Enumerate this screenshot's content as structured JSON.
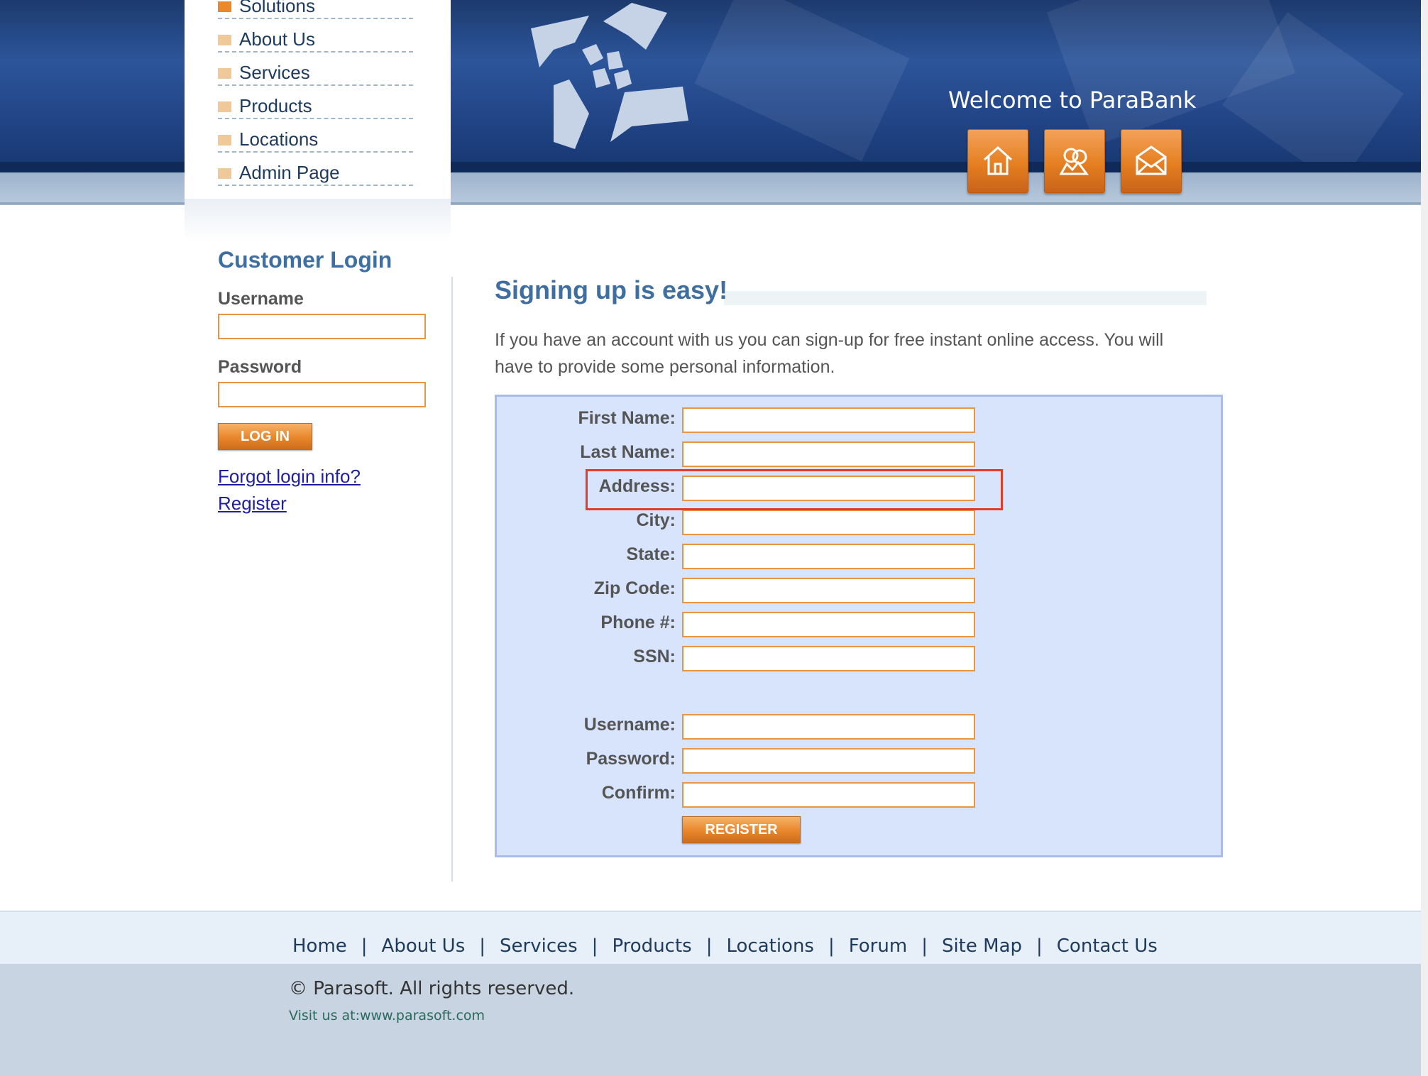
{
  "header": {
    "welcome": "Welcome to ParaBank",
    "icons": [
      "home-icon",
      "about-people-icon",
      "contact-mail-icon"
    ],
    "colors": {
      "band": "#25498c",
      "button": "#e57f21"
    }
  },
  "sidebar_nav": {
    "items": [
      {
        "label": "Solutions"
      },
      {
        "label": "About Us"
      },
      {
        "label": "Services"
      },
      {
        "label": "Products"
      },
      {
        "label": "Locations"
      },
      {
        "label": "Admin Page"
      }
    ]
  },
  "login": {
    "title": "Customer Login",
    "username_label": "Username",
    "username_value": "",
    "password_label": "Password",
    "password_value": "",
    "login_button": "LOG IN",
    "forgot_link": "Forgot login info?",
    "register_link": "Register"
  },
  "main": {
    "title": "Signing up is easy!",
    "intro": "If you have an account with us you can sign-up for free instant online access. You will have to provide some personal information.",
    "fields": {
      "first_name": {
        "label": "First Name:",
        "value": ""
      },
      "last_name": {
        "label": "Last Name:",
        "value": ""
      },
      "address": {
        "label": "Address:",
        "value": ""
      },
      "city": {
        "label": "City:",
        "value": ""
      },
      "state": {
        "label": "State:",
        "value": ""
      },
      "zip": {
        "label": "Zip Code:",
        "value": ""
      },
      "phone": {
        "label": "Phone #:",
        "value": ""
      },
      "ssn": {
        "label": "SSN:",
        "value": ""
      },
      "username": {
        "label": "Username:",
        "value": ""
      },
      "password": {
        "label": "Password:",
        "value": ""
      },
      "confirm": {
        "label": "Confirm:",
        "value": ""
      }
    },
    "register_button": "REGISTER",
    "highlight_color": "#e33b2a"
  },
  "footer": {
    "links": [
      "Home",
      "About Us",
      "Services",
      "Products",
      "Locations",
      "Forum",
      "Site Map",
      "Contact Us"
    ],
    "separator": "|",
    "copyright": "© Parasoft. All rights reserved.",
    "visit": "Visit us at:www.parasoft.com"
  }
}
